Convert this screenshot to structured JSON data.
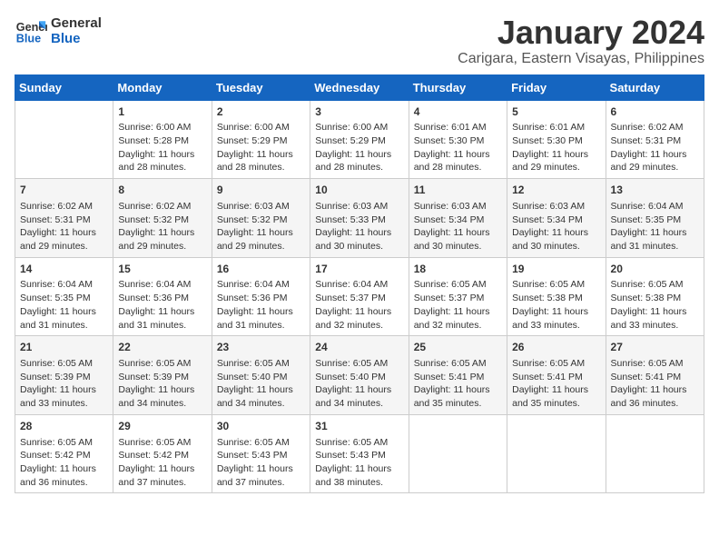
{
  "logo": {
    "line1": "General",
    "line2": "Blue"
  },
  "title": "January 2024",
  "subtitle": "Carigara, Eastern Visayas, Philippines",
  "days_of_week": [
    "Sunday",
    "Monday",
    "Tuesday",
    "Wednesday",
    "Thursday",
    "Friday",
    "Saturday"
  ],
  "weeks": [
    [
      {
        "day": "",
        "info": ""
      },
      {
        "day": "1",
        "info": "Sunrise: 6:00 AM\nSunset: 5:28 PM\nDaylight: 11 hours\nand 28 minutes."
      },
      {
        "day": "2",
        "info": "Sunrise: 6:00 AM\nSunset: 5:29 PM\nDaylight: 11 hours\nand 28 minutes."
      },
      {
        "day": "3",
        "info": "Sunrise: 6:00 AM\nSunset: 5:29 PM\nDaylight: 11 hours\nand 28 minutes."
      },
      {
        "day": "4",
        "info": "Sunrise: 6:01 AM\nSunset: 5:30 PM\nDaylight: 11 hours\nand 28 minutes."
      },
      {
        "day": "5",
        "info": "Sunrise: 6:01 AM\nSunset: 5:30 PM\nDaylight: 11 hours\nand 29 minutes."
      },
      {
        "day": "6",
        "info": "Sunrise: 6:02 AM\nSunset: 5:31 PM\nDaylight: 11 hours\nand 29 minutes."
      }
    ],
    [
      {
        "day": "7",
        "info": "Sunrise: 6:02 AM\nSunset: 5:31 PM\nDaylight: 11 hours\nand 29 minutes."
      },
      {
        "day": "8",
        "info": "Sunrise: 6:02 AM\nSunset: 5:32 PM\nDaylight: 11 hours\nand 29 minutes."
      },
      {
        "day": "9",
        "info": "Sunrise: 6:03 AM\nSunset: 5:32 PM\nDaylight: 11 hours\nand 29 minutes."
      },
      {
        "day": "10",
        "info": "Sunrise: 6:03 AM\nSunset: 5:33 PM\nDaylight: 11 hours\nand 30 minutes."
      },
      {
        "day": "11",
        "info": "Sunrise: 6:03 AM\nSunset: 5:34 PM\nDaylight: 11 hours\nand 30 minutes."
      },
      {
        "day": "12",
        "info": "Sunrise: 6:03 AM\nSunset: 5:34 PM\nDaylight: 11 hours\nand 30 minutes."
      },
      {
        "day": "13",
        "info": "Sunrise: 6:04 AM\nSunset: 5:35 PM\nDaylight: 11 hours\nand 31 minutes."
      }
    ],
    [
      {
        "day": "14",
        "info": "Sunrise: 6:04 AM\nSunset: 5:35 PM\nDaylight: 11 hours\nand 31 minutes."
      },
      {
        "day": "15",
        "info": "Sunrise: 6:04 AM\nSunset: 5:36 PM\nDaylight: 11 hours\nand 31 minutes."
      },
      {
        "day": "16",
        "info": "Sunrise: 6:04 AM\nSunset: 5:36 PM\nDaylight: 11 hours\nand 31 minutes."
      },
      {
        "day": "17",
        "info": "Sunrise: 6:04 AM\nSunset: 5:37 PM\nDaylight: 11 hours\nand 32 minutes."
      },
      {
        "day": "18",
        "info": "Sunrise: 6:05 AM\nSunset: 5:37 PM\nDaylight: 11 hours\nand 32 minutes."
      },
      {
        "day": "19",
        "info": "Sunrise: 6:05 AM\nSunset: 5:38 PM\nDaylight: 11 hours\nand 33 minutes."
      },
      {
        "day": "20",
        "info": "Sunrise: 6:05 AM\nSunset: 5:38 PM\nDaylight: 11 hours\nand 33 minutes."
      }
    ],
    [
      {
        "day": "21",
        "info": "Sunrise: 6:05 AM\nSunset: 5:39 PM\nDaylight: 11 hours\nand 33 minutes."
      },
      {
        "day": "22",
        "info": "Sunrise: 6:05 AM\nSunset: 5:39 PM\nDaylight: 11 hours\nand 34 minutes."
      },
      {
        "day": "23",
        "info": "Sunrise: 6:05 AM\nSunset: 5:40 PM\nDaylight: 11 hours\nand 34 minutes."
      },
      {
        "day": "24",
        "info": "Sunrise: 6:05 AM\nSunset: 5:40 PM\nDaylight: 11 hours\nand 34 minutes."
      },
      {
        "day": "25",
        "info": "Sunrise: 6:05 AM\nSunset: 5:41 PM\nDaylight: 11 hours\nand 35 minutes."
      },
      {
        "day": "26",
        "info": "Sunrise: 6:05 AM\nSunset: 5:41 PM\nDaylight: 11 hours\nand 35 minutes."
      },
      {
        "day": "27",
        "info": "Sunrise: 6:05 AM\nSunset: 5:41 PM\nDaylight: 11 hours\nand 36 minutes."
      }
    ],
    [
      {
        "day": "28",
        "info": "Sunrise: 6:05 AM\nSunset: 5:42 PM\nDaylight: 11 hours\nand 36 minutes."
      },
      {
        "day": "29",
        "info": "Sunrise: 6:05 AM\nSunset: 5:42 PM\nDaylight: 11 hours\nand 37 minutes."
      },
      {
        "day": "30",
        "info": "Sunrise: 6:05 AM\nSunset: 5:43 PM\nDaylight: 11 hours\nand 37 minutes."
      },
      {
        "day": "31",
        "info": "Sunrise: 6:05 AM\nSunset: 5:43 PM\nDaylight: 11 hours\nand 38 minutes."
      },
      {
        "day": "",
        "info": ""
      },
      {
        "day": "",
        "info": ""
      },
      {
        "day": "",
        "info": ""
      }
    ]
  ]
}
